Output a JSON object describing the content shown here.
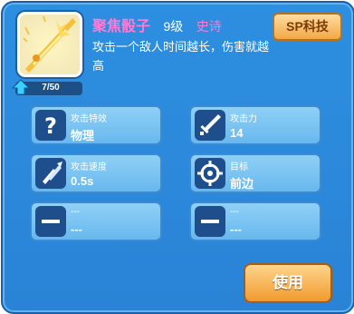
{
  "item": {
    "name": "聚焦骰子",
    "level": "9级",
    "rarity": "史诗",
    "description": "攻击一个敌人时间越长，伤害就越高",
    "progress_text": "7/50",
    "progress_value": 0.14
  },
  "header": {
    "sp_button_label": "SP科技"
  },
  "stats": [
    {
      "label": "攻击特效",
      "value": "物理",
      "icon": "question-icon"
    },
    {
      "label": "攻击力",
      "value": "14",
      "icon": "sword-icon"
    },
    {
      "label": "攻击速度",
      "value": "0.5s",
      "icon": "speed-icon"
    },
    {
      "label": "目标",
      "value": "前边",
      "icon": "target-icon"
    },
    {
      "label": "---",
      "value": "---",
      "icon": "dash-icon"
    },
    {
      "label": "---",
      "value": "---",
      "icon": "dash-icon"
    }
  ],
  "footer": {
    "use_button_label": "使用"
  },
  "colors": {
    "panel": "#2d8fe0",
    "card": "#8fd0f6",
    "accent_pink": "#ff7ad6",
    "button_orange": "#f09a2e"
  }
}
